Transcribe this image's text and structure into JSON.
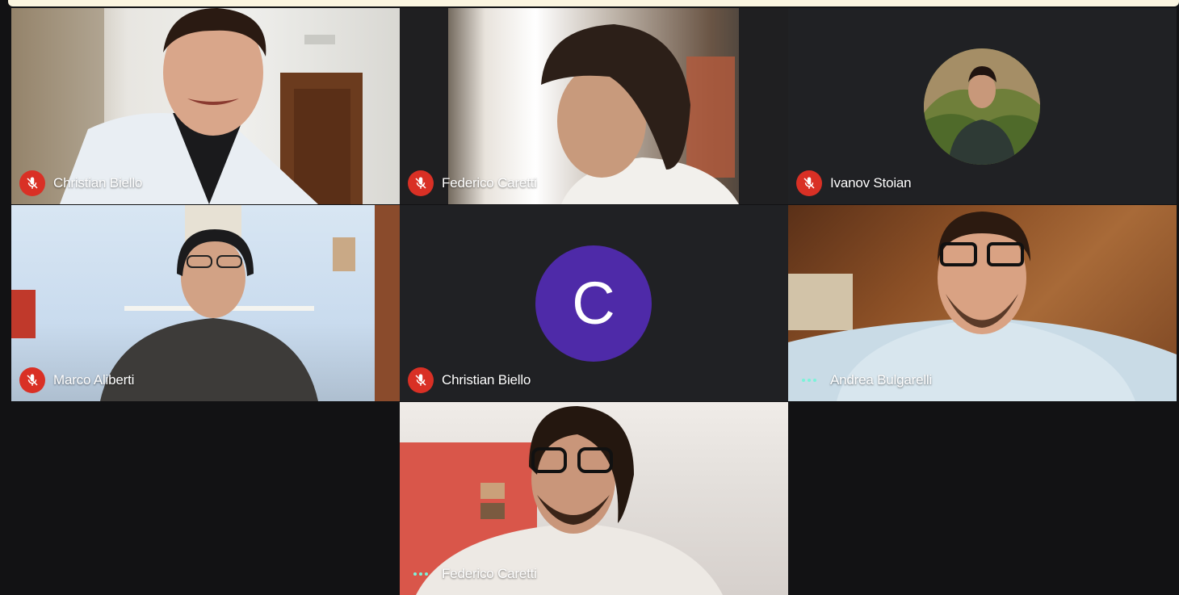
{
  "meeting": {
    "tiles": [
      {
        "name": "Christian Biello",
        "status": "muted",
        "display": "video"
      },
      {
        "name": "Federico Caretti",
        "status": "muted",
        "display": "video"
      },
      {
        "name": "Ivanov Stoian",
        "status": "muted",
        "display": "profile-photo"
      },
      {
        "name": "Marco Aliberti",
        "status": "muted",
        "display": "video"
      },
      {
        "name": "Christian Biello",
        "status": "muted",
        "display": "initial",
        "initial": "C",
        "avatar_color": "#4e2aa8"
      },
      {
        "name": "Andrea Bulgarelli",
        "status": "speaking",
        "display": "video"
      },
      {
        "name": "Federico Caretti",
        "status": "speaking",
        "display": "video"
      }
    ]
  },
  "colors": {
    "background": "#121214",
    "tile_background": "#202124",
    "mute_indicator": "#d93025",
    "speaking_indicator": "#7cf3d9",
    "banner": "#fbf5e0"
  },
  "icons": {
    "muted": "mic-off-icon",
    "speaking": "audio-dots-icon"
  }
}
